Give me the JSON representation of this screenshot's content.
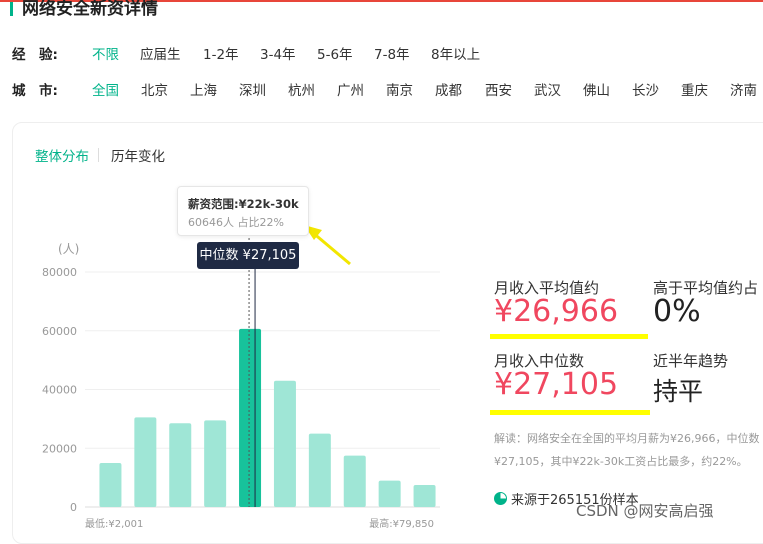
{
  "page": {
    "title": "网络安全新资详情"
  },
  "filters": {
    "experience": {
      "label": "经　验:",
      "options": [
        "不限",
        "应届生",
        "1-2年",
        "3-4年",
        "5-6年",
        "7-8年",
        "8年以上"
      ],
      "selected": "不限"
    },
    "city": {
      "label": "城　市:",
      "options": [
        "全国",
        "北京",
        "上海",
        "深圳",
        "杭州",
        "广州",
        "南京",
        "成都",
        "西安",
        "武汉",
        "佛山",
        "长沙",
        "重庆",
        "济南"
      ],
      "selected": "全国"
    }
  },
  "tabs": [
    "整体分布",
    "历年变化"
  ],
  "tooltip": {
    "title": "薪资范围:¥22k-30k",
    "detail": "60646人  占比22%"
  },
  "median_marker": "中位数 ¥27,105",
  "stats": {
    "avg_label": "月收入平均值约",
    "avg_value": "¥26,966",
    "above_avg_label": "高于平均值约占",
    "above_avg_value": "0%",
    "median_label": "月收入中位数",
    "median_value": "¥27,105",
    "trend_label": "近半年趋势",
    "trend_value": "持平"
  },
  "explanation": "解读：网络安全在全国的平均月薪为¥26,966，中位数¥27,105，其中¥22k-30k工资占比最多，约22%。",
  "source": "来源于265151份样本",
  "watermark": "CSDN @网安高启强",
  "colors": {
    "accent": "#00b38a",
    "bar": "#9fe6d6",
    "bar_highlight": "#17c29b",
    "price": "#f0475f",
    "highlight_marker": "#ffff00",
    "arrow": "#f2e600",
    "tooltip_dark": "#1f2a44"
  },
  "chart_data": {
    "type": "bar",
    "ylabel": "(人)",
    "ylim": [
      0,
      85000
    ],
    "yticks": [
      0,
      20000,
      40000,
      60000,
      80000
    ],
    "ytick_labels": [
      "0",
      "20000",
      "40000",
      "60000",
      "80000"
    ],
    "x_min_label": "最低:¥2,001",
    "x_max_label": "最高:¥79,850",
    "values": [
      15000,
      30500,
      28500,
      29500,
      60646,
      43000,
      25000,
      17500,
      9000,
      7500
    ],
    "highlight_index": 4,
    "median_index": 4,
    "grid": true
  }
}
